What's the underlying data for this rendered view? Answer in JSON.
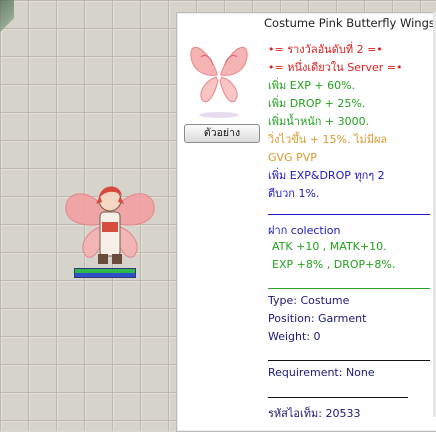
{
  "item": {
    "title": "Costume Pink Butterfly Wings",
    "preview_button": "ตัวอย่าง",
    "description": [
      {
        "text": "•= รางวัลอันดับที่ 2 =•",
        "color": "red"
      },
      {
        "text": "•= หนึ่งเดียวใน Server =•",
        "color": "red"
      },
      {
        "text": "เพิ่ม EXP  + 60%.",
        "color": "green"
      },
      {
        "text": "เพิ่ม DROP + 25%.",
        "color": "green"
      },
      {
        "text": "เพิ่มน้ำหนัก + 3000.",
        "color": "green"
      },
      {
        "text": "วิ่งไวขึ้น + 15%. ไม่มีผล",
        "color": "orange"
      },
      {
        "text": "GVG PVP",
        "color": "orange"
      },
      {
        "text": "เพิ่ม EXP&DROP ทุกๆ 2",
        "color": "blue"
      },
      {
        "text": "ตีบวก 1%.",
        "color": "blue"
      }
    ],
    "collection": {
      "header": "ฝาก colection",
      "lines": [
        "ATK +10 , MATK+10.",
        "EXP +8% , DROP+8%."
      ]
    },
    "type": "Type: Costume",
    "position": "Position: Garment",
    "weight": "Weight: 0",
    "requirement": "Requirement: None",
    "item_id": "รหัสไอเท็ม: 20533"
  },
  "character": {
    "hp_fraction": 1.0,
    "sp_fraction": 1.0
  },
  "colors": {
    "red": "#e0201e",
    "green": "#22a21d",
    "orange": "#d99a2e",
    "blue": "#1a1ac8"
  }
}
